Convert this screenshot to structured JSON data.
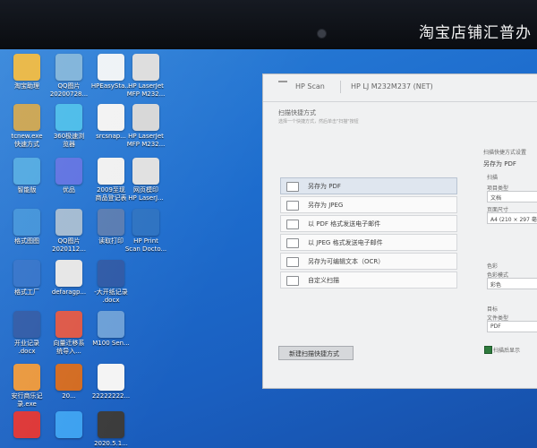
{
  "overlay": {
    "watermark": "淘宝店铺汇普办"
  },
  "desktop": {
    "icons": [
      {
        "label": "淘宝助理",
        "icon": "app-icon",
        "color": "#e8b33a"
      },
      {
        "label": "QQ图片\n20200728...",
        "icon": "image-icon",
        "color": "#7ab0d8"
      },
      {
        "label": "HPEasySta...",
        "icon": "hp-icon",
        "color": "#eef2f6"
      },
      {
        "label": "HP LaserJet\nMFP M232...",
        "icon": "printer-icon",
        "color": "#dcdcdc"
      },
      {
        "label": "tcnew.exe\n快速方式",
        "icon": "app-icon",
        "color": "#c8a04a"
      },
      {
        "label": "360极速浏\n览器",
        "icon": "browser-icon",
        "color": "#44b9e8"
      },
      {
        "label": "srcsnap...",
        "icon": "exe-icon",
        "color": "#f2f2f2"
      },
      {
        "label": "HP LaserJet\nMFP M232...",
        "icon": "printer-icon",
        "color": "#d6d6d6"
      },
      {
        "label": "智能版",
        "icon": "app-icon",
        "color": "#4aa5e0"
      },
      {
        "label": "优品",
        "icon": "app-icon",
        "color": "#5a6ee0"
      },
      {
        "label": "2009至现\n商品登记表",
        "icon": "document-icon",
        "color": "#f0f0f0"
      },
      {
        "label": "网页模印\nHP LaserJ...",
        "icon": "printer-icon",
        "color": "#e0e0e0"
      },
      {
        "label": "格式图图",
        "icon": "app-icon",
        "color": "#3b8fd8"
      },
      {
        "label": "QQ图片\n2020112...",
        "icon": "image-icon",
        "color": "#a0b8d0"
      },
      {
        "label": "读取打印",
        "icon": "app-icon",
        "color": "#5579b0"
      },
      {
        "label": "HP Print\nScan Docto...",
        "icon": "hp-icon",
        "color": "#2a70c0"
      },
      {
        "label": "格式工厂",
        "icon": "app-icon",
        "color": "#2e6fc8"
      },
      {
        "label": "defaragp...",
        "icon": "image-icon",
        "color": "#e6e6e6"
      },
      {
        "label": "-大开纸记录\n.docx",
        "icon": "word-icon",
        "color": "#2b57a5"
      },
      {
        "label": "",
        "icon": "blank",
        "color": "transparent"
      },
      {
        "label": "开业记录\n.docx",
        "icon": "word-icon",
        "color": "#2b57a5"
      },
      {
        "label": "向量迁移系\n统导入...",
        "icon": "app-icon",
        "color": "#d54"
      },
      {
        "label": "M100 Sen...",
        "icon": "app-icon",
        "color": "#6a9ed6"
      },
      {
        "label": "",
        "icon": "blank",
        "color": "transparent"
      },
      {
        "label": "安行商乐记\n录.exe",
        "icon": "exe-icon",
        "color": "#e9963a"
      },
      {
        "label": "20...",
        "icon": "app-icon",
        "color": "#d2691e"
      },
      {
        "label": "22222222...",
        "icon": "document-icon",
        "color": "#f4f4f4"
      },
      {
        "label": "",
        "icon": "blank",
        "color": "transparent"
      },
      {
        "label": "",
        "icon": "app-icon",
        "color": "#d33"
      },
      {
        "label": "",
        "icon": "app-icon",
        "color": "#3aa0f0"
      },
      {
        "label": "2020.5.1...",
        "icon": "app-icon",
        "color": "#3a3a3a"
      },
      {
        "label": "",
        "icon": "blank",
        "color": "transparent"
      }
    ]
  },
  "scan_dialog": {
    "brand": "HP Scan",
    "device": "HP LJ M232M237 (NET)",
    "shortcuts_heading": "扫描快捷方式",
    "shortcuts_hint": "选择一个快捷方式，然后单击\"扫描\"按钮",
    "shortcuts": [
      {
        "label": "另存为 PDF",
        "selected": true
      },
      {
        "label": "另存为 JPEG",
        "selected": false
      },
      {
        "label": "以 PDF 格式发送电子邮件",
        "selected": false
      },
      {
        "label": "以 JPEG 格式发送电子邮件",
        "selected": false
      },
      {
        "label": "另存为可编辑文本（OCR）",
        "selected": false
      },
      {
        "label": "自定义扫描",
        "selected": false
      }
    ],
    "new_shortcut_button": "新建扫描快捷方式",
    "right_panel": {
      "section": "扫描快捷方式设置",
      "subtitle": "另存为 PDF",
      "scan_label": "扫描",
      "item_type_label": "项目类型",
      "item_type": "文档",
      "page_size_label": "页面尺寸",
      "page_size": "A4 (210 × 297 毫米)",
      "color_mode_label": "色彩",
      "color_mode_sub": "色彩模式",
      "color_mode": "彩色",
      "destination_label": "目标",
      "file_type_label": "文件类型",
      "file_type": "PDF",
      "checkbox_label": "扫描后显示"
    }
  }
}
